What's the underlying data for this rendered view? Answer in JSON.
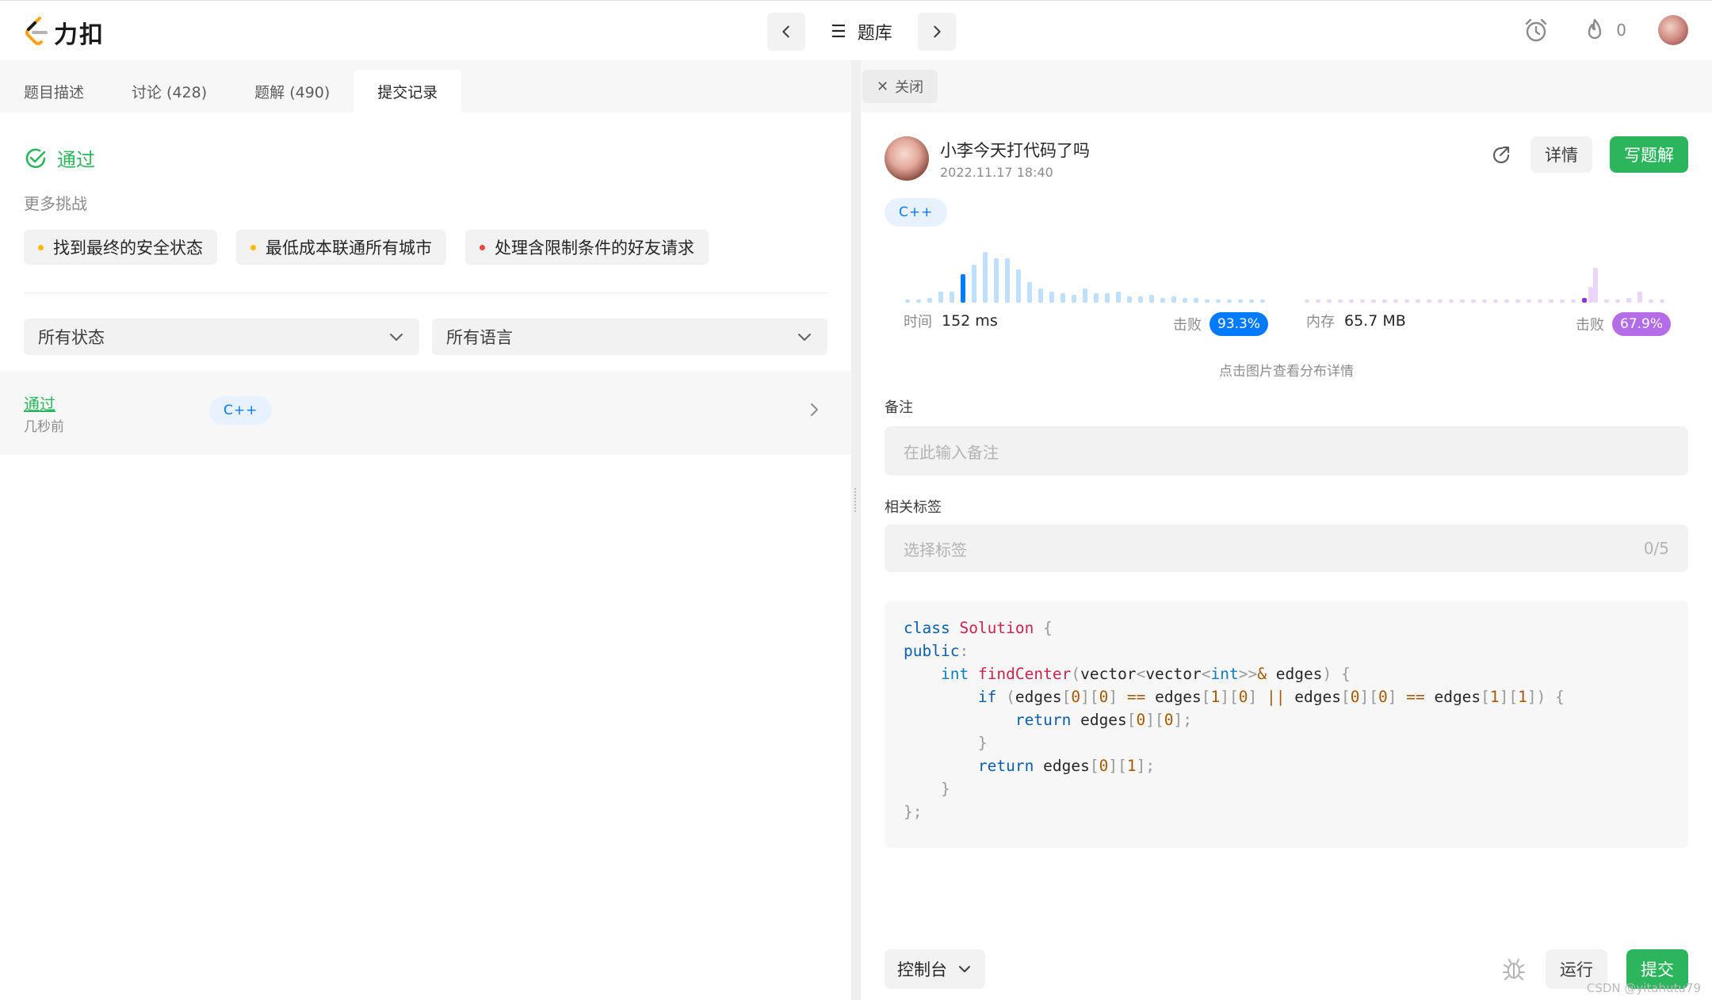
{
  "header": {
    "logo_text": "力扣",
    "problem_list_label": "题库",
    "fire_count": "0"
  },
  "left": {
    "tabs": [
      {
        "label": "题目描述"
      },
      {
        "label": "讨论 (428)"
      },
      {
        "label": "题解 (490)"
      },
      {
        "label": "提交记录"
      }
    ],
    "status": "通过",
    "more_challenges_label": "更多挑战",
    "challenges": [
      {
        "label": "找到最终的安全状态",
        "color": "#ffb800"
      },
      {
        "label": "最低成本联通所有城市",
        "color": "#ffb800"
      },
      {
        "label": "处理含限制条件的好友请求",
        "color": "#ef4743"
      }
    ],
    "filter_status": "所有状态",
    "filter_language": "所有语言",
    "submission": {
      "status": "通过",
      "time": "几秒前",
      "language": "C++"
    }
  },
  "right": {
    "close_label": "关闭",
    "author": "小李今天打代码了吗",
    "date": "2022.11.17 18:40",
    "details_label": "详情",
    "write_solution_label": "写题解",
    "language": "C++",
    "runtime": {
      "label": "时间",
      "value": "152 ms",
      "beat_label": "击败",
      "beat": "93.3%",
      "color": "#007aff"
    },
    "memory": {
      "label": "内存",
      "value": "65.7 MB",
      "beat_label": "击败",
      "beat": "67.9%",
      "color": "#b46de6"
    },
    "hint": "点击图片查看分布详情",
    "notes_label": "备注",
    "notes_placeholder": "在此输入备注",
    "tags_label": "相关标签",
    "tags_placeholder": "选择标签",
    "tags_count": "0/5",
    "console_label": "控制台",
    "run_label": "运行",
    "submit_label": "提交"
  },
  "watermark": "CSDN @yitahutu79"
}
